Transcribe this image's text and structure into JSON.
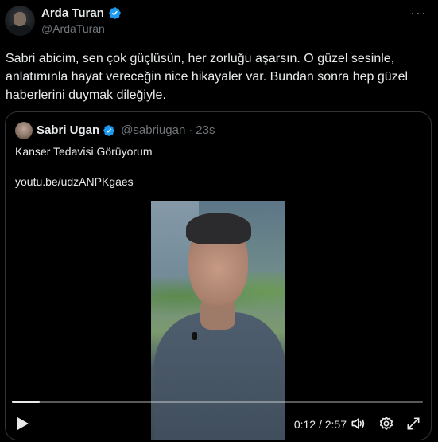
{
  "author": {
    "name": "Arda Turan",
    "handle": "@ArdaTuran"
  },
  "more_icon": "···",
  "tweet_text": "Sabri abicim, sen çok güçlüsün, her zorluğu aşarsın. O güzel sesinle, anlatımınla hayat vereceğin nice hikayaler var. Bundan sonra hep güzel haberlerini duymak dileğiyle.",
  "quote": {
    "name": "Sabri Ugan",
    "handle": "@sabriugan",
    "separator": "·",
    "time": "23s",
    "text": "Kanser Tedavisi Görüyorum",
    "link": "youtu.be/udzANPKgaes",
    "video": {
      "current_time": "0:12",
      "duration": "2:57",
      "time_display": "0:12 / 2:57",
      "progress_fraction": 0.068
    }
  },
  "colors": {
    "verified": "#1d9bf0",
    "background": "#000000",
    "text": "#e7e9ea",
    "muted": "#71767b",
    "border": "#2f3336"
  },
  "icons": [
    "verified-badge-icon",
    "more-icon",
    "play-icon",
    "volume-icon",
    "settings-gear-icon",
    "fullscreen-icon"
  ]
}
